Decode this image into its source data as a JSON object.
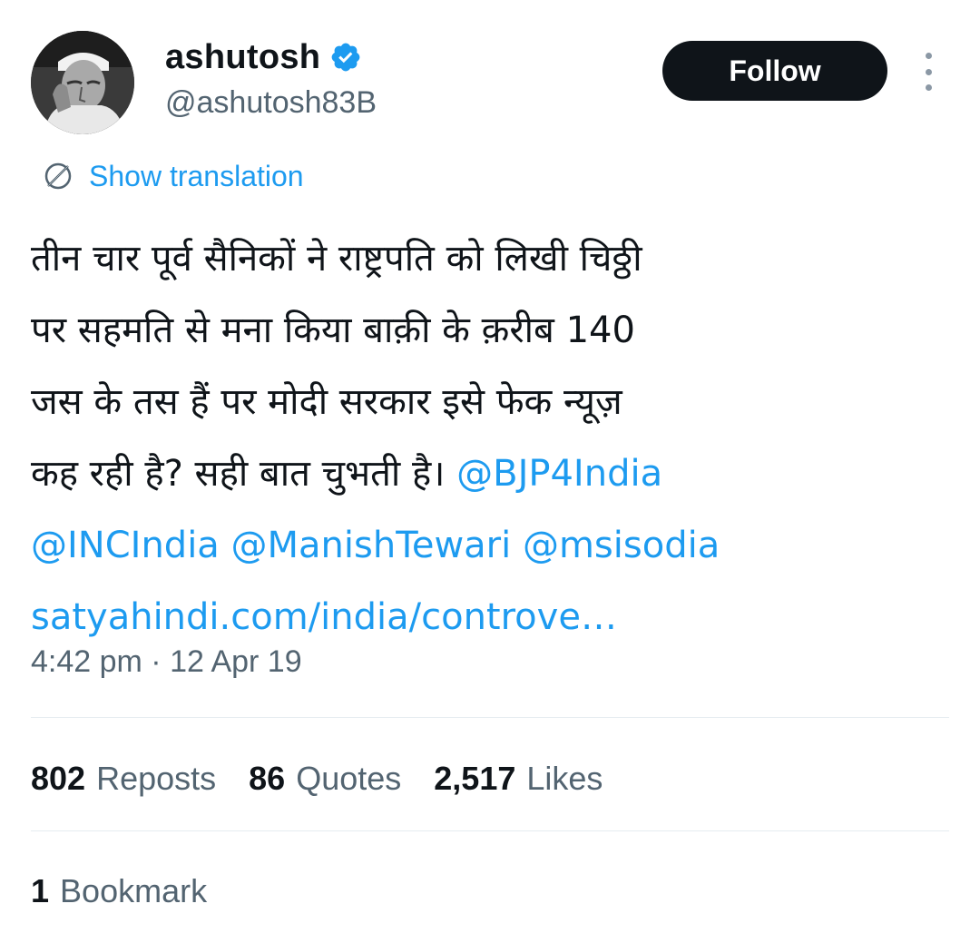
{
  "author": {
    "name": "ashutosh",
    "handle": "@ashutosh83B",
    "verified": true,
    "avatar_icon": "portrait-avatar"
  },
  "actions": {
    "follow_label": "Follow",
    "more_icon": "more-vertical-icon"
  },
  "translation": {
    "label": "Show translation",
    "icon": "translate-icon"
  },
  "tweet": {
    "lines": [
      "तीन चार पूर्व सैनिकों ने राष्ट्रपति को लिखी चिठ्ठी",
      "पर सहमति से मना किया बाक़ी के क़रीब 140",
      "जस के तस हैं पर मोदी सरकार इसे फेक न्यूज़",
      "कह रही है? सही बात चुभती है।"
    ],
    "mentions": [
      "@BJP4India",
      "@INCIndia",
      "@ManishTewari",
      "@msisodia"
    ],
    "link": "satyahindi.com/india/controve…"
  },
  "timestamp": "4:42 pm · 12 Apr 19",
  "stats": {
    "reposts": {
      "count": "802",
      "label": "Reposts"
    },
    "quotes": {
      "count": "86",
      "label": "Quotes"
    },
    "likes": {
      "count": "2,517",
      "label": "Likes"
    },
    "bookmarks": {
      "count": "1",
      "label": "Bookmark"
    }
  },
  "colors": {
    "accent": "#1d9bf0",
    "text": "#0f1419",
    "secondary": "#536471",
    "button_bg": "#0f1419"
  }
}
